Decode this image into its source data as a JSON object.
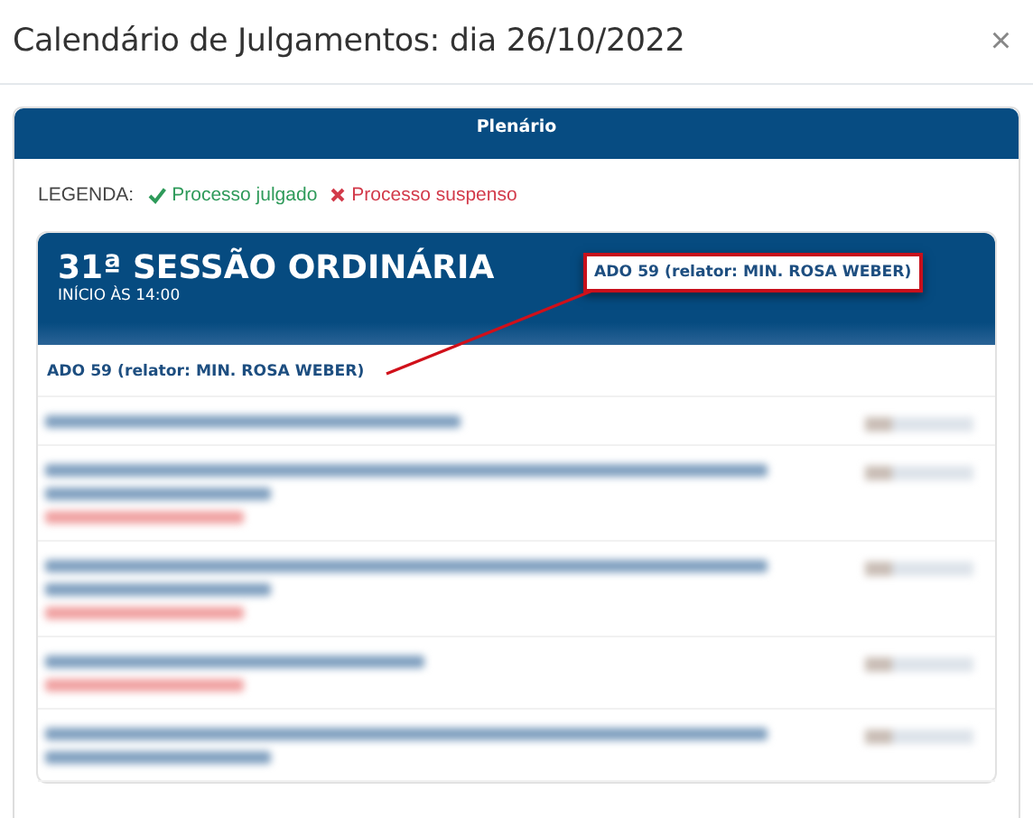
{
  "dialog": {
    "title": "Calendário de Julgamentos: dia 26/10/2022",
    "close": "×"
  },
  "panel": {
    "title": "Plenário"
  },
  "legend": {
    "label": "LEGENDA:",
    "items": [
      {
        "kind": "judged",
        "text": "Processo julgado"
      },
      {
        "kind": "suspended",
        "text": "Processo suspenso"
      }
    ]
  },
  "session": {
    "title": "31ª SESSÃO ORDINÁRIA",
    "start": "INÍCIO ÀS 14:00",
    "callout": "ADO 59 (relator: MIN. ROSA WEBER)"
  },
  "rows": [
    {
      "kind": "case",
      "text": "ADO 59 (relator: MIN. ROSA WEBER)"
    },
    {
      "kind": "blurred-short",
      "suspended": false
    },
    {
      "kind": "blurred-long",
      "suspended": true
    },
    {
      "kind": "blurred-long",
      "suspended": true
    },
    {
      "kind": "blurred-short",
      "suspended": true
    },
    {
      "kind": "blurred-long",
      "suspended": false
    }
  ]
}
